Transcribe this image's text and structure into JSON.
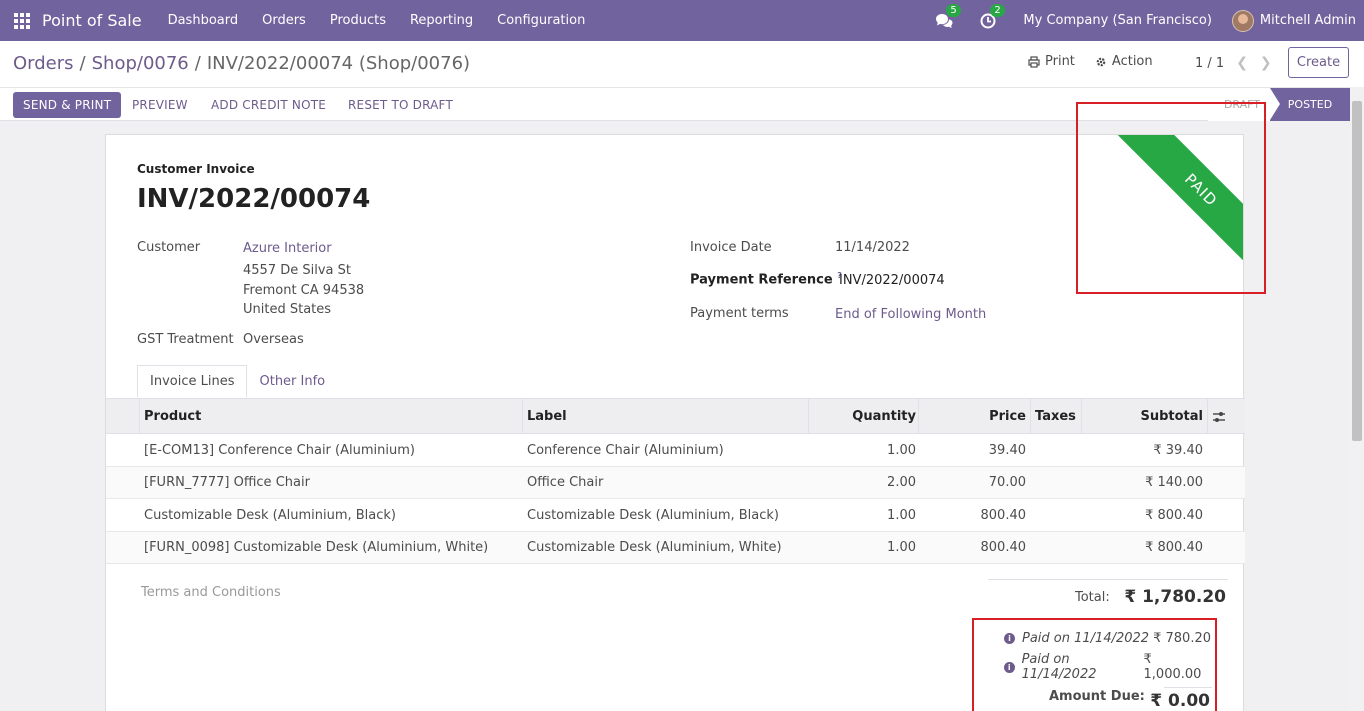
{
  "navbar": {
    "app_name": "Point of Sale",
    "menu": [
      "Dashboard",
      "Orders",
      "Products",
      "Reporting",
      "Configuration"
    ],
    "messages_count": "5",
    "activities_count": "2",
    "company": "My Company (San Francisco)",
    "user": "Mitchell Admin"
  },
  "breadcrumb": {
    "items": [
      "Orders",
      "Shop/0076"
    ],
    "current": "INV/2022/00074 (Shop/0076)"
  },
  "control": {
    "print_label": "Print",
    "action_label": "Action",
    "pager": "1 / 1",
    "create_label": "Create"
  },
  "header_buttons": {
    "send_print": "SEND & PRINT",
    "preview": "PREVIEW",
    "add_credit_note": "ADD CREDIT NOTE",
    "reset_to_draft": "RESET TO DRAFT"
  },
  "status": {
    "draft": "DRAFT",
    "posted": "POSTED"
  },
  "ribbon": "PAID",
  "invoice": {
    "type": "Customer Invoice",
    "name": "INV/2022/00074",
    "customer_label": "Customer",
    "customer_name": "Azure Interior",
    "address_line1": "4557 De Silva St",
    "address_line2": "Fremont CA 94538",
    "address_line3": "United States",
    "gst_label": "GST Treatment",
    "gst_value": "Overseas",
    "invoice_date_label": "Invoice Date",
    "invoice_date": "11/14/2022",
    "payment_ref_label": "Payment Reference",
    "payment_ref_help": "?",
    "payment_ref": "INV/2022/00074",
    "payment_terms_label": "Payment terms",
    "payment_terms": "End of Following Month"
  },
  "tabs": [
    "Invoice Lines",
    "Other Info"
  ],
  "lines": {
    "headers": {
      "product": "Product",
      "label": "Label",
      "quantity": "Quantity",
      "price": "Price",
      "taxes": "Taxes",
      "subtotal": "Subtotal"
    },
    "rows": [
      {
        "product": "[E-COM13] Conference Chair (Aluminium)",
        "label": "Conference Chair (Aluminium)",
        "quantity": "1.00",
        "price": "39.40",
        "taxes": "",
        "subtotal": "₹ 39.40"
      },
      {
        "product": "[FURN_7777] Office Chair",
        "label": "Office Chair",
        "quantity": "2.00",
        "price": "70.00",
        "taxes": "",
        "subtotal": "₹ 140.00"
      },
      {
        "product": "Customizable Desk (Aluminium, Black)",
        "label": "Customizable Desk (Aluminium, Black)",
        "quantity": "1.00",
        "price": "800.40",
        "taxes": "",
        "subtotal": "₹ 800.40"
      },
      {
        "product": "[FURN_0098] Customizable Desk (Aluminium, White)",
        "label": "Customizable Desk (Aluminium, White)",
        "quantity": "1.00",
        "price": "800.40",
        "taxes": "",
        "subtotal": "₹ 800.40"
      }
    ]
  },
  "footer": {
    "terms_placeholder": "Terms and Conditions",
    "total_label": "Total:",
    "total_value": "₹ 1,780.20",
    "payments": [
      {
        "text": "Paid on 11/14/2022",
        "amount": "₹ 780.20"
      },
      {
        "text": "Paid on 11/14/2022",
        "amount": "₹ 1,000.00"
      }
    ],
    "amount_due_label": "Amount Due:",
    "amount_due_value": "₹ 0.00"
  },
  "colors": {
    "brand": "#71639e",
    "paid_ribbon": "#28a745",
    "highlight_box": "#d81f26"
  }
}
